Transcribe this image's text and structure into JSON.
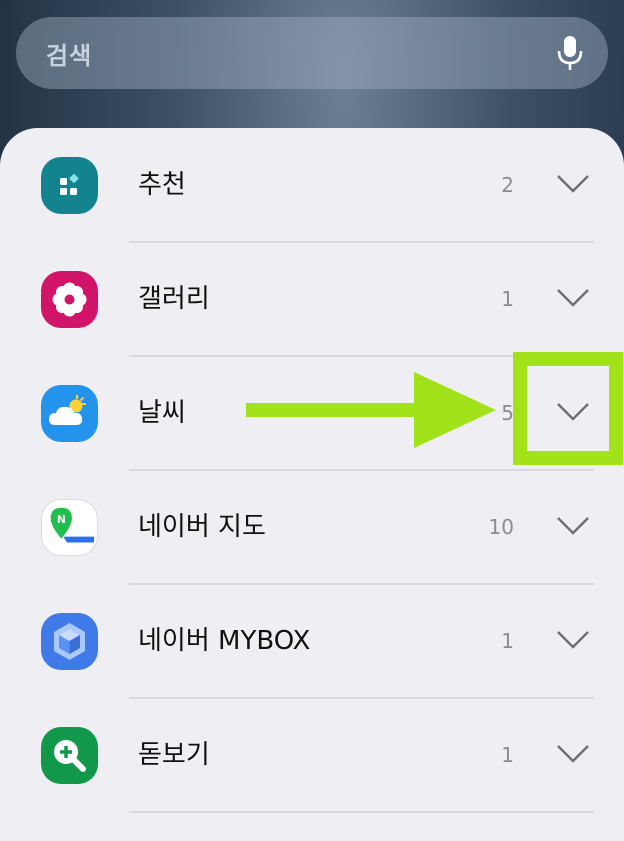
{
  "search": {
    "placeholder": "검색",
    "mic_icon": "microphone-icon"
  },
  "apps": [
    {
      "name": "추천",
      "count": "2",
      "icon": "recommend-icon",
      "color": "#13838f"
    },
    {
      "name": "갤러리",
      "count": "1",
      "icon": "gallery-flower-icon",
      "color": "#d11469"
    },
    {
      "name": "날씨",
      "count": "5",
      "icon": "weather-icon",
      "color": "#2393ec"
    },
    {
      "name": "네이버 지도",
      "count": "10",
      "icon": "naver-map-icon",
      "color": "#ffffff"
    },
    {
      "name": "네이버 MYBOX",
      "count": "1",
      "icon": "naver-mybox-icon",
      "color": "#3f7ae8"
    },
    {
      "name": "돋보기",
      "count": "1",
      "icon": "magnifier-icon",
      "color": "#12984b"
    }
  ],
  "annotation": {
    "color": "#a2e21a",
    "target": "날씨 expand chevron"
  }
}
